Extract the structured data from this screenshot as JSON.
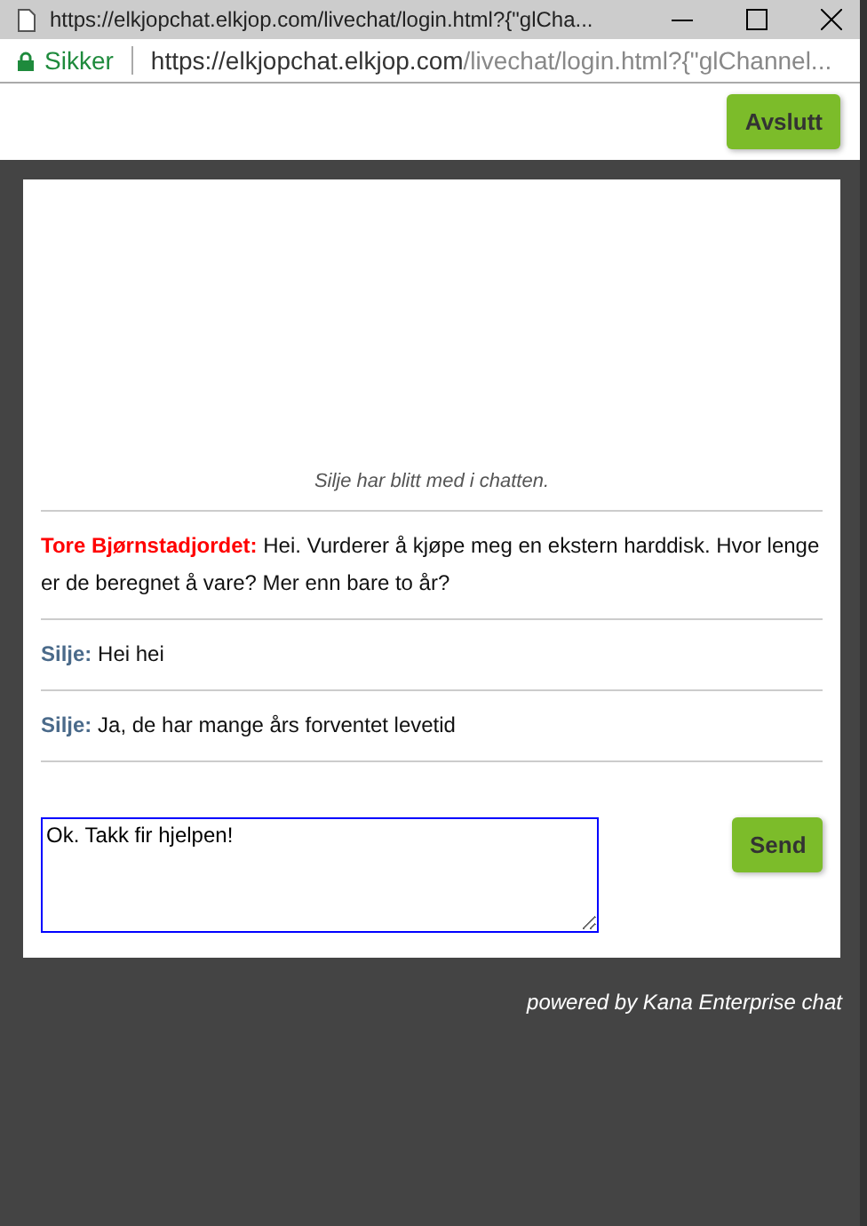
{
  "window": {
    "title": "https://elkjopchat.elkjop.com/livechat/login.html?{\"glCha..."
  },
  "address_bar": {
    "security": "Sikker",
    "url_host": "https://elkjopchat.elkjop.com",
    "url_path": "/livechat/login.html?{\"glChannel..."
  },
  "end_button": "Avslutt",
  "chat": {
    "system_message": "Silje har blitt med i chatten.",
    "messages": [
      {
        "sender": "Tore Bjørnstadjordet:",
        "color": "#ff0000",
        "text": "Hei. Vurderer å kjøpe meg en ekstern harddisk. Hvor lenge er de beregnet å vare? Mer enn bare to år?"
      },
      {
        "sender": "Silje:",
        "color": "#4a6a8a",
        "text": "Hei hei"
      },
      {
        "sender": "Silje:",
        "color": "#4a6a8a",
        "text": "Ja, de har mange års forventet levetid"
      }
    ],
    "input_value": "Ok. Takk fir hjelpen!",
    "send_button": "Send"
  },
  "footer": "powered by Kana Enterprise chat"
}
